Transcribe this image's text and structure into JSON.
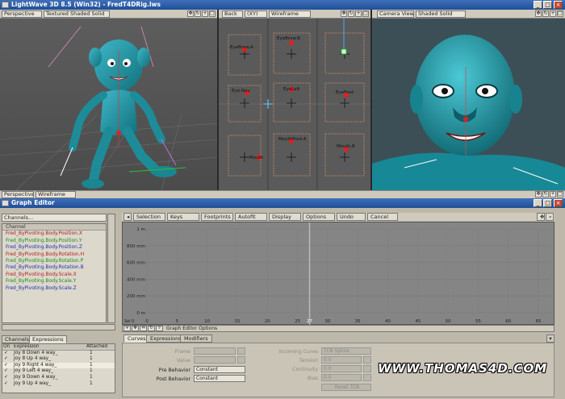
{
  "window": {
    "title": "LightWave 3D 8.5 (Win32) - FredT4DRig.lws"
  },
  "viewports": [
    {
      "view": "Perspective",
      "shading": "Textured Shaded Solid"
    },
    {
      "view": "Back",
      "axis": "(XY)",
      "shading": "Wireframe"
    },
    {
      "view": "Camera View",
      "shading": "Shaded Solid"
    }
  ],
  "bottom_bar": {
    "view": "Perspective",
    "shading": "Wireframe"
  },
  "face_controls": [
    "EyeBrow.A",
    "EyeBrow.B",
    "Eye.Nav",
    "EyeLeft",
    "EyeFred",
    "Mouth",
    "MouthFred.A",
    "Mouth.B"
  ],
  "graph_editor": {
    "title": "Graph Editor",
    "channels_dropdown": "Channels...",
    "channel_header": "Channel",
    "channels": [
      {
        "name": "Fred_ByPivoting.Body.Position.X",
        "color": "#b02020"
      },
      {
        "name": "Fred_ByPivoting.Body.Position.Y",
        "color": "#1f8a1f"
      },
      {
        "name": "Fred_ByPivoting.Body.Position.Z",
        "color": "#2030b0"
      },
      {
        "name": "Fred_ByPivoting.Body.Rotation.H",
        "color": "#b02020"
      },
      {
        "name": "Fred_ByPivoting.Body.Rotation.P",
        "color": "#1f8a1f"
      },
      {
        "name": "Fred_ByPivoting.Body.Rotation.B",
        "color": "#2030b0"
      },
      {
        "name": "Fred_ByPivoting.Body.Scale.X",
        "color": "#b02020"
      },
      {
        "name": "Fred_ByPivoting.Body.Scale.Y",
        "color": "#1f8a1f"
      },
      {
        "name": "Fred_ByPivoting.Body.Scale.Z",
        "color": "#2030b0"
      }
    ],
    "left_tabs": [
      "Channels",
      "Expressions"
    ],
    "expr_headers": {
      "on": "On",
      "expression": "Expression",
      "attached": "Attached"
    },
    "expressions": [
      {
        "name": "Joy 8 Down 4 way_",
        "attached": "1"
      },
      {
        "name": "Joy 8 Up 4 way_",
        "attached": "1"
      },
      {
        "name": "Joy 9 Right 4 way_",
        "attached": "1"
      },
      {
        "name": "Joy 9 Left 4 way_",
        "attached": "1"
      },
      {
        "name": "Joy 9 Down 4 way_",
        "attached": "1"
      },
      {
        "name": "Joy 9 Up 4 way_",
        "attached": "1"
      }
    ],
    "menus": [
      "Selection",
      "Keys",
      "Footprints",
      "Autofit",
      "Display",
      "Options",
      "Undo",
      "Cancel"
    ],
    "y_labels": [
      "1 m",
      "800 mm",
      "600 mm",
      "400 mm",
      "200 mm",
      "0 m"
    ],
    "x_labels": [
      "0",
      "5",
      "10",
      "15",
      "20",
      "25",
      "27",
      "30",
      "35",
      "40",
      "45",
      "50",
      "55",
      "60",
      "65"
    ],
    "sel_label": "Sel 0",
    "options_label": "Graph Editor Options",
    "curve_tabs": [
      "Curves",
      "Expressions",
      "Modifiers"
    ],
    "fields": {
      "frame": "Frame",
      "value": "Value",
      "pre_behavior": "Pre Behavior",
      "pre_behavior_value": "Constant",
      "post_behavior": "Post Behavior",
      "post_behavior_value": "Constant",
      "incoming_curve": "Incoming Curve",
      "incoming_curve_value": "TCB Spline",
      "tension": "Tension",
      "tension_value": "0.0",
      "continuity": "Continuity",
      "continuity_value": "0.0",
      "bias": "Bias",
      "bias_value": "0.0",
      "reset_label": "Reset TCB"
    }
  },
  "watermark": "WWW.THOMAS4D.COM"
}
